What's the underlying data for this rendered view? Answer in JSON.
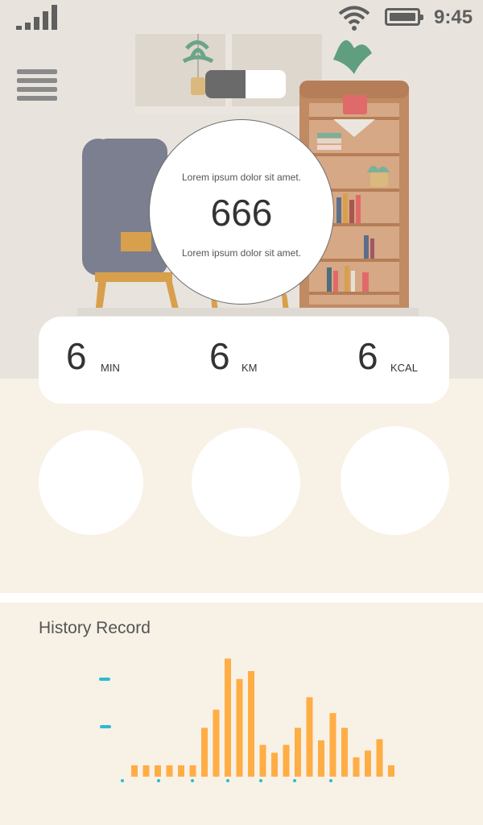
{
  "status_bar": {
    "time": "9:45",
    "signal_icon": "signal-bars-icon",
    "wifi_icon": "wifi-icon",
    "battery_icon": "battery-icon"
  },
  "header": {
    "menu_icon": "hamburger-menu-icon",
    "toggle_state": "on"
  },
  "summary": {
    "top_text": "Lorem ipsum dolor sit amet.",
    "value": "666",
    "bottom_text": "Lorem ipsum dolor sit amet."
  },
  "stats": [
    {
      "value": "6",
      "unit": "MIN"
    },
    {
      "value": "6",
      "unit": "KM"
    },
    {
      "value": "6",
      "unit": "KCAL"
    }
  ],
  "history": {
    "title": "History Record"
  },
  "colors": {
    "bar": "#ffad45",
    "axis_dot": "#2bbcd0",
    "background": "#f8f1e6",
    "hero": "#e8e4dd"
  },
  "chart_data": {
    "type": "bar",
    "title": "",
    "values": [
      1,
      1,
      1,
      1,
      1,
      1,
      4.3,
      5.9,
      10.4,
      8.6,
      9.3,
      2.8,
      2.1,
      2.8,
      4.3,
      7.0,
      3.2,
      5.6,
      4.3,
      1.7,
      2.3,
      3.3,
      1
    ],
    "ylim": [
      0,
      11
    ],
    "grid": false,
    "legend": "none"
  }
}
